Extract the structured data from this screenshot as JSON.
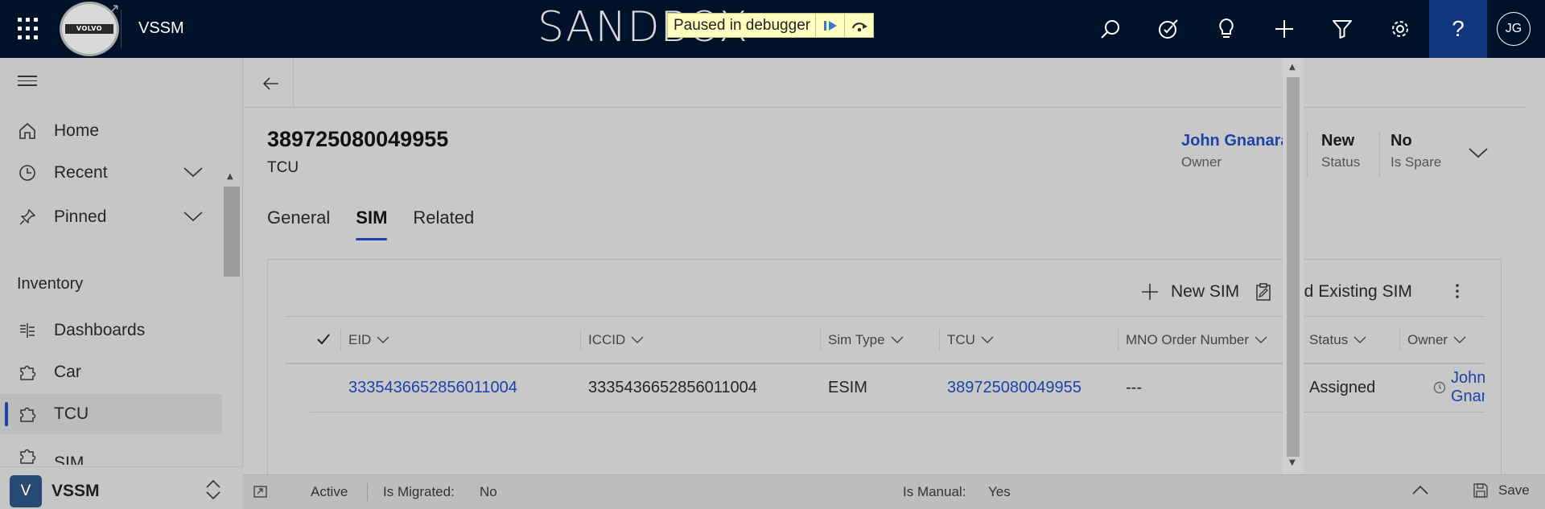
{
  "topbar": {
    "app_name": "VSSM",
    "logo_text": "VOLVO",
    "environment_banner": "SANDBOX",
    "debugger_text": "Paused in debugger",
    "help_label": "?",
    "user_initials": "JG",
    "icons": [
      "search-icon",
      "target-icon",
      "lightbulb-icon",
      "plus-icon",
      "filter-icon",
      "gear-icon"
    ]
  },
  "sidebar": {
    "items": [
      {
        "label": "Home",
        "icon": "home-icon"
      },
      {
        "label": "Recent",
        "icon": "clock-icon"
      },
      {
        "label": "Pinned",
        "icon": "pin-icon"
      }
    ],
    "group_title": "Inventory",
    "group_items": [
      {
        "label": "Dashboards",
        "icon": "dashboard-icon"
      },
      {
        "label": "Car",
        "icon": "puzzle-icon"
      },
      {
        "label": "TCU",
        "icon": "puzzle-icon",
        "selected": true
      },
      {
        "label": "SIM",
        "icon": "puzzle-icon"
      }
    ],
    "footer": {
      "badge": "V",
      "area_name": "VSSM"
    }
  },
  "record": {
    "title": "389725080049955",
    "entity": "TCU",
    "header_fields": [
      {
        "value": "John Gnanaraj",
        "caption": "Owner",
        "is_link": true
      },
      {
        "value": "New",
        "caption": "Status"
      },
      {
        "value": "No",
        "caption": "Is Spare"
      }
    ],
    "tabs": [
      "General",
      "SIM",
      "Related"
    ],
    "active_tab": "SIM"
  },
  "subgrid": {
    "commands": {
      "new": "New SIM",
      "add_existing": "Add Existing SIM"
    },
    "columns": [
      "EID",
      "ICCID",
      "Sim Type",
      "TCU",
      "MNO Order Number",
      "Status",
      "Owner"
    ],
    "rows": [
      {
        "eid": "3335436652856011004",
        "iccid": "3335436652856011004",
        "sim_type": "ESIM",
        "tcu": "389725080049955",
        "mno_order_number": "---",
        "status": "Assigned",
        "owner": "John Gnanaraj"
      }
    ]
  },
  "footer": {
    "state": "Active",
    "migrated_label": "Is Migrated:",
    "migrated_value": "No",
    "manual_label": "Is Manual:",
    "manual_value": "Yes",
    "save_label": "Save"
  },
  "colors": {
    "topbar_bg": "#00112a",
    "help_bg": "#12357f",
    "accent": "#1b43a8",
    "debugger_bg": "#ffffc0"
  }
}
